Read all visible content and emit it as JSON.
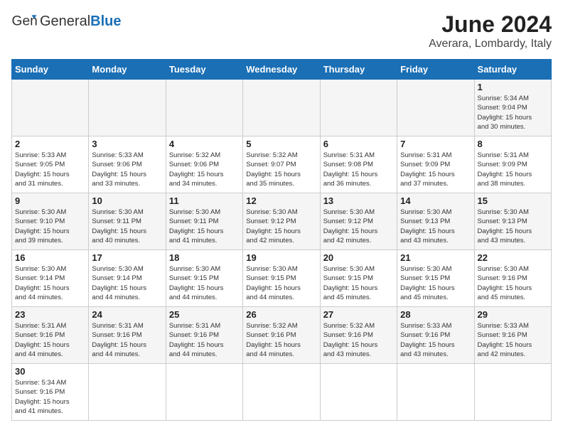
{
  "logo": {
    "text_general": "General",
    "text_blue": "Blue"
  },
  "title": "June 2024",
  "subtitle": "Averara, Lombardy, Italy",
  "days_of_week": [
    "Sunday",
    "Monday",
    "Tuesday",
    "Wednesday",
    "Thursday",
    "Friday",
    "Saturday"
  ],
  "weeks": [
    [
      {
        "day": "",
        "info": ""
      },
      {
        "day": "",
        "info": ""
      },
      {
        "day": "",
        "info": ""
      },
      {
        "day": "",
        "info": ""
      },
      {
        "day": "",
        "info": ""
      },
      {
        "day": "",
        "info": ""
      },
      {
        "day": "1",
        "info": "Sunrise: 5:34 AM\nSunset: 9:04 PM\nDaylight: 15 hours\nand 30 minutes."
      }
    ],
    [
      {
        "day": "2",
        "info": "Sunrise: 5:33 AM\nSunset: 9:05 PM\nDaylight: 15 hours\nand 31 minutes."
      },
      {
        "day": "3",
        "info": "Sunrise: 5:33 AM\nSunset: 9:06 PM\nDaylight: 15 hours\nand 33 minutes."
      },
      {
        "day": "4",
        "info": "Sunrise: 5:32 AM\nSunset: 9:06 PM\nDaylight: 15 hours\nand 34 minutes."
      },
      {
        "day": "5",
        "info": "Sunrise: 5:32 AM\nSunset: 9:07 PM\nDaylight: 15 hours\nand 35 minutes."
      },
      {
        "day": "6",
        "info": "Sunrise: 5:31 AM\nSunset: 9:08 PM\nDaylight: 15 hours\nand 36 minutes."
      },
      {
        "day": "7",
        "info": "Sunrise: 5:31 AM\nSunset: 9:09 PM\nDaylight: 15 hours\nand 37 minutes."
      },
      {
        "day": "8",
        "info": "Sunrise: 5:31 AM\nSunset: 9:09 PM\nDaylight: 15 hours\nand 38 minutes."
      }
    ],
    [
      {
        "day": "9",
        "info": "Sunrise: 5:30 AM\nSunset: 9:10 PM\nDaylight: 15 hours\nand 39 minutes."
      },
      {
        "day": "10",
        "info": "Sunrise: 5:30 AM\nSunset: 9:11 PM\nDaylight: 15 hours\nand 40 minutes."
      },
      {
        "day": "11",
        "info": "Sunrise: 5:30 AM\nSunset: 9:11 PM\nDaylight: 15 hours\nand 41 minutes."
      },
      {
        "day": "12",
        "info": "Sunrise: 5:30 AM\nSunset: 9:12 PM\nDaylight: 15 hours\nand 42 minutes."
      },
      {
        "day": "13",
        "info": "Sunrise: 5:30 AM\nSunset: 9:12 PM\nDaylight: 15 hours\nand 42 minutes."
      },
      {
        "day": "14",
        "info": "Sunrise: 5:30 AM\nSunset: 9:13 PM\nDaylight: 15 hours\nand 43 minutes."
      },
      {
        "day": "15",
        "info": "Sunrise: 5:30 AM\nSunset: 9:13 PM\nDaylight: 15 hours\nand 43 minutes."
      }
    ],
    [
      {
        "day": "16",
        "info": "Sunrise: 5:30 AM\nSunset: 9:14 PM\nDaylight: 15 hours\nand 44 minutes."
      },
      {
        "day": "17",
        "info": "Sunrise: 5:30 AM\nSunset: 9:14 PM\nDaylight: 15 hours\nand 44 minutes."
      },
      {
        "day": "18",
        "info": "Sunrise: 5:30 AM\nSunset: 9:15 PM\nDaylight: 15 hours\nand 44 minutes."
      },
      {
        "day": "19",
        "info": "Sunrise: 5:30 AM\nSunset: 9:15 PM\nDaylight: 15 hours\nand 44 minutes."
      },
      {
        "day": "20",
        "info": "Sunrise: 5:30 AM\nSunset: 9:15 PM\nDaylight: 15 hours\nand 45 minutes."
      },
      {
        "day": "21",
        "info": "Sunrise: 5:30 AM\nSunset: 9:15 PM\nDaylight: 15 hours\nand 45 minutes."
      },
      {
        "day": "22",
        "info": "Sunrise: 5:30 AM\nSunset: 9:16 PM\nDaylight: 15 hours\nand 45 minutes."
      }
    ],
    [
      {
        "day": "23",
        "info": "Sunrise: 5:31 AM\nSunset: 9:16 PM\nDaylight: 15 hours\nand 44 minutes."
      },
      {
        "day": "24",
        "info": "Sunrise: 5:31 AM\nSunset: 9:16 PM\nDaylight: 15 hours\nand 44 minutes."
      },
      {
        "day": "25",
        "info": "Sunrise: 5:31 AM\nSunset: 9:16 PM\nDaylight: 15 hours\nand 44 minutes."
      },
      {
        "day": "26",
        "info": "Sunrise: 5:32 AM\nSunset: 9:16 PM\nDaylight: 15 hours\nand 44 minutes."
      },
      {
        "day": "27",
        "info": "Sunrise: 5:32 AM\nSunset: 9:16 PM\nDaylight: 15 hours\nand 43 minutes."
      },
      {
        "day": "28",
        "info": "Sunrise: 5:33 AM\nSunset: 9:16 PM\nDaylight: 15 hours\nand 43 minutes."
      },
      {
        "day": "29",
        "info": "Sunrise: 5:33 AM\nSunset: 9:16 PM\nDaylight: 15 hours\nand 42 minutes."
      }
    ],
    [
      {
        "day": "30",
        "info": "Sunrise: 5:34 AM\nSunset: 9:16 PM\nDaylight: 15 hours\nand 41 minutes."
      },
      {
        "day": "",
        "info": ""
      },
      {
        "day": "",
        "info": ""
      },
      {
        "day": "",
        "info": ""
      },
      {
        "day": "",
        "info": ""
      },
      {
        "day": "",
        "info": ""
      },
      {
        "day": "",
        "info": ""
      }
    ]
  ],
  "accent_color": "#1a6fb5"
}
